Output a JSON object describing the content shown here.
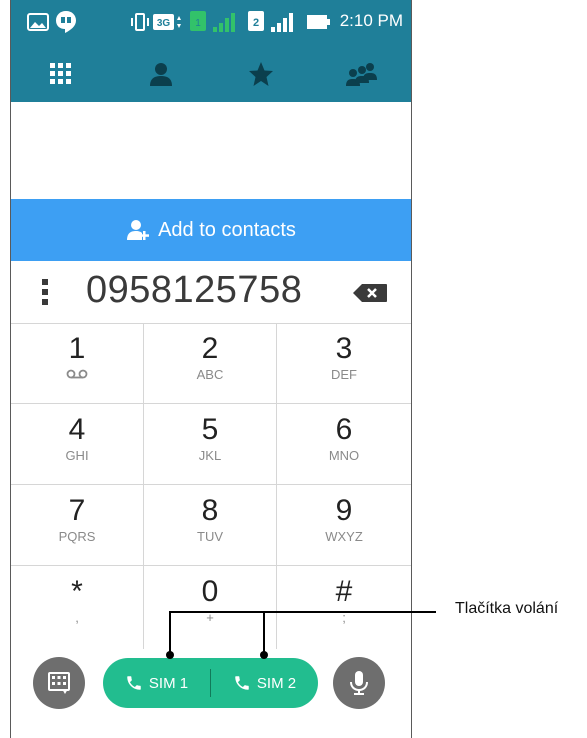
{
  "status_bar": {
    "time": "2:10 PM",
    "icons": [
      "image-icon",
      "hangouts-icon",
      "vibrate-icon",
      "3g-icon",
      "sim1-signal-icon",
      "sim2-signal-icon",
      "battery-icon"
    ],
    "sim2_label": "2"
  },
  "tabs": [
    {
      "name": "dialpad",
      "icon": "dialpad-icon"
    },
    {
      "name": "contacts",
      "icon": "person-icon"
    },
    {
      "name": "favorites",
      "icon": "star-icon"
    },
    {
      "name": "groups",
      "icon": "group-icon"
    }
  ],
  "add_contacts": {
    "label": "Add to contacts",
    "icon": "add-contact-icon"
  },
  "dialed_number": "0958125758",
  "keypad": [
    {
      "digit": "1",
      "letters": "",
      "icon": "voicemail-icon"
    },
    {
      "digit": "2",
      "letters": "ABC"
    },
    {
      "digit": "3",
      "letters": "DEF"
    },
    {
      "digit": "4",
      "letters": "GHI"
    },
    {
      "digit": "5",
      "letters": "JKL"
    },
    {
      "digit": "6",
      "letters": "MNO"
    },
    {
      "digit": "7",
      "letters": "PQRS"
    },
    {
      "digit": "8",
      "letters": "TUV"
    },
    {
      "digit": "9",
      "letters": "WXYZ"
    },
    {
      "digit": "*",
      "letters": ","
    },
    {
      "digit": "0",
      "letters": "+"
    },
    {
      "digit": "#",
      "letters": ";"
    }
  ],
  "call_buttons": {
    "sim1": "SIM 1",
    "sim2": "SIM 2"
  },
  "callout": {
    "label": "Tlačítka volání"
  },
  "colors": {
    "header": "#1f7f99",
    "add_contacts_bar": "#3d9ff3",
    "call_pill": "#22bd8f",
    "round_buttons": "#6e6e6e"
  }
}
